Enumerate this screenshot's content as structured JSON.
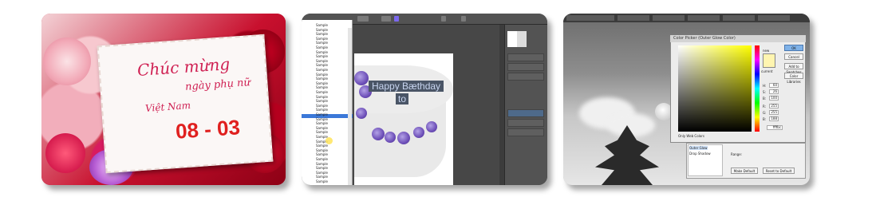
{
  "thumbnails": [
    {
      "greeting_title": "Chúc mừng",
      "greeting_sub": "ngày phụ nữ",
      "country": "Việt Nam",
      "date": "08 - 03",
      "colors": {
        "accent": "#c8102e",
        "text": "#cf1f52",
        "date": "#e0201f"
      }
    },
    {
      "canvas_text_line1": "Happy Bæthday",
      "canvas_text_line2": "to",
      "font_items": [
        "Sample",
        "Sample",
        "Sample",
        "Sample",
        "Sample",
        "Sample",
        "Sample",
        "Sample",
        "Sample",
        "Sample",
        "Sample",
        "Sample",
        "Sample",
        "Sample",
        "Sample",
        "Sample",
        "Sample",
        "Sample",
        "Sample",
        "Sample",
        "Sample",
        "Sample",
        "Sample",
        "Sample",
        "Sample",
        "Sample",
        "Sample",
        "Sample",
        "Sample",
        "Sample",
        "Sample",
        "Sample",
        "Sample",
        "Sample",
        "Sample",
        "Sample"
      ]
    },
    {
      "dialog_title": "Color Picker (Outer Glow Color)",
      "ok_label": "OK",
      "cancel_label": "Cancel",
      "swatches_label": "Add to Swatches",
      "libraries_label": "Color Libraries",
      "new_label": "new",
      "current_label": "current",
      "only_web_colors": "Only Web Colors",
      "fields": [
        {
          "label": "H:",
          "value": "60"
        },
        {
          "label": "S:",
          "value": "26"
        },
        {
          "label": "B:",
          "value": "100"
        },
        {
          "label": "R:",
          "value": "255"
        },
        {
          "label": "G:",
          "value": "255"
        },
        {
          "label": "B:",
          "value": "188"
        }
      ],
      "hex_value": "ffffbc",
      "panel_items": [
        "Outer Glow",
        "Drop Shadow"
      ],
      "make_default": "Make Default",
      "reset_default": "Reset to Default",
      "range_label": "Range:"
    }
  ]
}
